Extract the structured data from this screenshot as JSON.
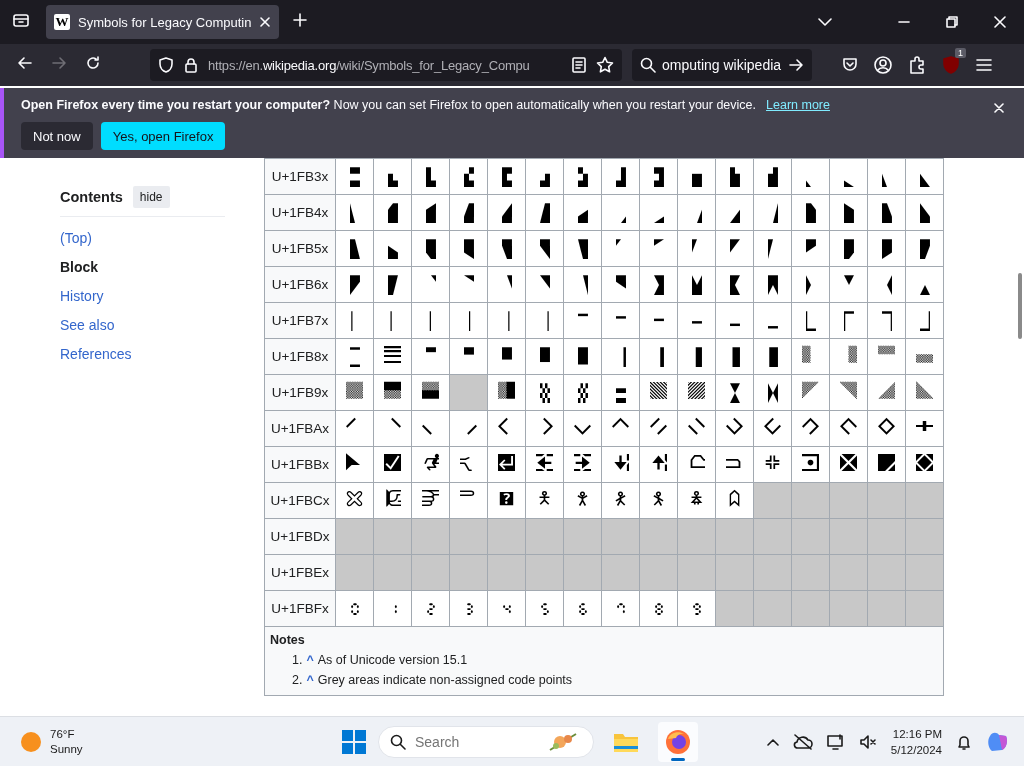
{
  "browser": {
    "tab": {
      "title": "Symbols for Legacy Computin",
      "favicon": "W",
      "selected": true
    },
    "navigation": {
      "back_disabled": false,
      "forward_disabled": true
    },
    "url": {
      "prefix": "https://en.",
      "domain": "wikipedia.org",
      "path": "/wiki/Symbols_for_Legacy_Compu"
    },
    "search": {
      "value": "omputing wikipedia"
    },
    "extension_badge": "1"
  },
  "notification": {
    "message": "**Open Firefox every time you restart your computer?** Now you can set Firefox to open automatically when you restart your device.",
    "link": "Learn more",
    "buttons": [
      {
        "label": "Not now",
        "kind": "secondary"
      },
      {
        "label": "Yes, open Firefox",
        "kind": "primary"
      }
    ]
  },
  "contents": {
    "title": "Contents",
    "toggle": "hide",
    "items": [
      {
        "label": "(Top)",
        "selected": false
      },
      {
        "label": "Block",
        "selected": true
      },
      {
        "label": "History",
        "selected": false
      },
      {
        "label": "See also",
        "selected": false
      },
      {
        "label": "References",
        "selected": false
      }
    ]
  },
  "table": {
    "rows": [
      {
        "label": "U+1FB3x",
        "cells": [
          {
            "char": "🬰",
            "assigned": true
          },
          {
            "char": "🬱",
            "assigned": true
          },
          {
            "char": "🬲",
            "assigned": true
          },
          {
            "char": "🬳",
            "assigned": true
          },
          {
            "char": "🬴",
            "assigned": true
          },
          {
            "char": "🬵",
            "assigned": true
          },
          {
            "char": "🬶",
            "assigned": true
          },
          {
            "char": "🬷",
            "assigned": true
          },
          {
            "char": "🬸",
            "assigned": true
          },
          {
            "char": "🬹",
            "assigned": true
          },
          {
            "char": "🬺",
            "assigned": true
          },
          {
            "char": "🬻",
            "assigned": true
          },
          {
            "char": "🬼",
            "assigned": true
          },
          {
            "char": "🬽",
            "assigned": true
          },
          {
            "char": "🬾",
            "assigned": true
          },
          {
            "char": "🬿",
            "assigned": true
          }
        ]
      },
      {
        "label": "U+1FB4x",
        "cells": [
          {
            "char": "🭀",
            "assigned": true
          },
          {
            "char": "🭁",
            "assigned": true
          },
          {
            "char": "🭂",
            "assigned": true
          },
          {
            "char": "🭃",
            "assigned": true
          },
          {
            "char": "🭄",
            "assigned": true
          },
          {
            "char": "🭅",
            "assigned": true
          },
          {
            "char": "🭆",
            "assigned": true
          },
          {
            "char": "🭇",
            "assigned": true
          },
          {
            "char": "🭈",
            "assigned": true
          },
          {
            "char": "🭉",
            "assigned": true
          },
          {
            "char": "🭊",
            "assigned": true
          },
          {
            "char": "🭋",
            "assigned": true
          },
          {
            "char": "🭌",
            "assigned": true
          },
          {
            "char": "🭍",
            "assigned": true
          },
          {
            "char": "🭎",
            "assigned": true
          },
          {
            "char": "🭏",
            "assigned": true
          }
        ]
      },
      {
        "label": "U+1FB5x",
        "cells": [
          {
            "char": "🭐",
            "assigned": true
          },
          {
            "char": "🭑",
            "assigned": true
          },
          {
            "char": "🭒",
            "assigned": true
          },
          {
            "char": "🭓",
            "assigned": true
          },
          {
            "char": "🭔",
            "assigned": true
          },
          {
            "char": "🭕",
            "assigned": true
          },
          {
            "char": "🭖",
            "assigned": true
          },
          {
            "char": "🭗",
            "assigned": true
          },
          {
            "char": "🭘",
            "assigned": true
          },
          {
            "char": "🭙",
            "assigned": true
          },
          {
            "char": "🭚",
            "assigned": true
          },
          {
            "char": "🭛",
            "assigned": true
          },
          {
            "char": "🭜",
            "assigned": true
          },
          {
            "char": "🭝",
            "assigned": true
          },
          {
            "char": "🭞",
            "assigned": true
          },
          {
            "char": "🭟",
            "assigned": true
          }
        ]
      },
      {
        "label": "U+1FB6x",
        "cells": [
          {
            "char": "🭠",
            "assigned": true
          },
          {
            "char": "🭡",
            "assigned": true
          },
          {
            "char": "🭢",
            "assigned": true
          },
          {
            "char": "🭣",
            "assigned": true
          },
          {
            "char": "🭤",
            "assigned": true
          },
          {
            "char": "🭥",
            "assigned": true
          },
          {
            "char": "🭦",
            "assigned": true
          },
          {
            "char": "🭧",
            "assigned": true
          },
          {
            "char": "🭨",
            "assigned": true
          },
          {
            "char": "🭩",
            "assigned": true
          },
          {
            "char": "🭪",
            "assigned": true
          },
          {
            "char": "🭫",
            "assigned": true
          },
          {
            "char": "🭬",
            "assigned": true
          },
          {
            "char": "🭭",
            "assigned": true
          },
          {
            "char": "🭮",
            "assigned": true
          },
          {
            "char": "🭯",
            "assigned": true
          }
        ]
      },
      {
        "label": "U+1FB7x",
        "cells": [
          {
            "char": "🭰",
            "assigned": true
          },
          {
            "char": "🭱",
            "assigned": true
          },
          {
            "char": "🭲",
            "assigned": true
          },
          {
            "char": "🭳",
            "assigned": true
          },
          {
            "char": "🭴",
            "assigned": true
          },
          {
            "char": "🭵",
            "assigned": true
          },
          {
            "char": "🭶",
            "assigned": true
          },
          {
            "char": "🭷",
            "assigned": true
          },
          {
            "char": "🭸",
            "assigned": true
          },
          {
            "char": "🭹",
            "assigned": true
          },
          {
            "char": "🭺",
            "assigned": true
          },
          {
            "char": "🭻",
            "assigned": true
          },
          {
            "char": "🭼",
            "assigned": true
          },
          {
            "char": "🭽",
            "assigned": true
          },
          {
            "char": "🭾",
            "assigned": true
          },
          {
            "char": "🭿",
            "assigned": true
          }
        ]
      },
      {
        "label": "U+1FB8x",
        "cells": [
          {
            "char": "🮀",
            "assigned": true
          },
          {
            "char": "🮁",
            "assigned": true
          },
          {
            "char": "🮂",
            "assigned": true
          },
          {
            "char": "🮃",
            "assigned": true
          },
          {
            "char": "🮄",
            "assigned": true
          },
          {
            "char": "🮅",
            "assigned": true
          },
          {
            "char": "🮆",
            "assigned": true
          },
          {
            "char": "🮇",
            "assigned": true
          },
          {
            "char": "🮈",
            "assigned": true
          },
          {
            "char": "🮉",
            "assigned": true
          },
          {
            "char": "🮊",
            "assigned": true
          },
          {
            "char": "🮋",
            "assigned": true
          },
          {
            "char": "🮌",
            "assigned": true
          },
          {
            "char": "🮍",
            "assigned": true
          },
          {
            "char": "🮎",
            "assigned": true
          },
          {
            "char": "🮏",
            "assigned": true
          }
        ]
      },
      {
        "label": "U+1FB9x",
        "cells": [
          {
            "char": "🮐",
            "assigned": true
          },
          {
            "char": "🮑",
            "assigned": true
          },
          {
            "char": "🮒",
            "assigned": true
          },
          {
            "assigned": false
          },
          {
            "char": "🮔",
            "assigned": true
          },
          {
            "char": "🮕",
            "assigned": true
          },
          {
            "char": "🮖",
            "assigned": true
          },
          {
            "char": "🮗",
            "assigned": true
          },
          {
            "char": "🮘",
            "assigned": true
          },
          {
            "char": "🮙",
            "assigned": true
          },
          {
            "char": "🮚",
            "assigned": true
          },
          {
            "char": "🮛",
            "assigned": true
          },
          {
            "char": "🮜",
            "assigned": true
          },
          {
            "char": "🮝",
            "assigned": true
          },
          {
            "char": "🮞",
            "assigned": true
          },
          {
            "char": "🮟",
            "assigned": true
          }
        ]
      },
      {
        "label": "U+1FBAx",
        "cells": [
          {
            "char": "🮠",
            "assigned": true
          },
          {
            "char": "🮡",
            "assigned": true
          },
          {
            "char": "🮢",
            "assigned": true
          },
          {
            "char": "🮣",
            "assigned": true
          },
          {
            "char": "🮤",
            "assigned": true
          },
          {
            "char": "🮥",
            "assigned": true
          },
          {
            "char": "🮦",
            "assigned": true
          },
          {
            "char": "🮧",
            "assigned": true
          },
          {
            "char": "🮨",
            "assigned": true
          },
          {
            "char": "🮩",
            "assigned": true
          },
          {
            "char": "🮪",
            "assigned": true
          },
          {
            "char": "🮫",
            "assigned": true
          },
          {
            "char": "🮬",
            "assigned": true
          },
          {
            "char": "🮭",
            "assigned": true
          },
          {
            "char": "🮮",
            "assigned": true
          },
          {
            "char": "🮯",
            "assigned": true
          }
        ]
      },
      {
        "label": "U+1FBBx",
        "cells": [
          {
            "char": "🮰",
            "assigned": true
          },
          {
            "char": "🮱",
            "assigned": true
          },
          {
            "char": "🮲",
            "assigned": true
          },
          {
            "char": "🮳",
            "assigned": true
          },
          {
            "char": "🮴",
            "assigned": true
          },
          {
            "char": "🮵",
            "assigned": true
          },
          {
            "char": "🮶",
            "assigned": true
          },
          {
            "char": "🮷",
            "assigned": true
          },
          {
            "char": "🮸",
            "assigned": true
          },
          {
            "char": "🮹",
            "assigned": true
          },
          {
            "char": "🮺",
            "assigned": true
          },
          {
            "char": "🮻",
            "assigned": true
          },
          {
            "char": "🮼",
            "assigned": true
          },
          {
            "char": "🮽",
            "assigned": true
          },
          {
            "char": "🮾",
            "assigned": true
          },
          {
            "char": "🮿",
            "assigned": true
          }
        ]
      },
      {
        "label": "U+1FBCx",
        "cells": [
          {
            "char": "🯀",
            "assigned": true
          },
          {
            "char": "🯁",
            "assigned": true
          },
          {
            "char": "🯂",
            "assigned": true
          },
          {
            "char": "🯃",
            "assigned": true
          },
          {
            "char": "🯄",
            "assigned": true
          },
          {
            "char": "🯅",
            "assigned": true
          },
          {
            "char": "🯆",
            "assigned": true
          },
          {
            "char": "🯇",
            "assigned": true
          },
          {
            "char": "🯈",
            "assigned": true
          },
          {
            "char": "🯉",
            "assigned": true
          },
          {
            "char": "🯊",
            "assigned": true
          },
          {
            "assigned": false
          },
          {
            "assigned": false
          },
          {
            "assigned": false
          },
          {
            "assigned": false
          },
          {
            "assigned": false
          }
        ]
      },
      {
        "label": "U+1FBDx",
        "cells": [
          {
            "assigned": false
          },
          {
            "assigned": false
          },
          {
            "assigned": false
          },
          {
            "assigned": false
          },
          {
            "assigned": false
          },
          {
            "assigned": false
          },
          {
            "assigned": false
          },
          {
            "assigned": false
          },
          {
            "assigned": false
          },
          {
            "assigned": false
          },
          {
            "assigned": false
          },
          {
            "assigned": false
          },
          {
            "assigned": false
          },
          {
            "assigned": false
          },
          {
            "assigned": false
          },
          {
            "assigned": false
          }
        ]
      },
      {
        "label": "U+1FBEx",
        "cells": [
          {
            "assigned": false
          },
          {
            "assigned": false
          },
          {
            "assigned": false
          },
          {
            "assigned": false
          },
          {
            "assigned": false
          },
          {
            "assigned": false
          },
          {
            "assigned": false
          },
          {
            "assigned": false
          },
          {
            "assigned": false
          },
          {
            "assigned": false
          },
          {
            "assigned": false
          },
          {
            "assigned": false
          },
          {
            "assigned": false
          },
          {
            "assigned": false
          },
          {
            "assigned": false
          },
          {
            "assigned": false
          }
        ]
      },
      {
        "label": "U+1FBFx",
        "cells": [
          {
            "char": "🯰",
            "assigned": true
          },
          {
            "char": "🯱",
            "assigned": true
          },
          {
            "char": "🯲",
            "assigned": true
          },
          {
            "char": "🯳",
            "assigned": true
          },
          {
            "char": "🯴",
            "assigned": true
          },
          {
            "char": "🯵",
            "assigned": true
          },
          {
            "char": "🯶",
            "assigned": true
          },
          {
            "char": "🯷",
            "assigned": true
          },
          {
            "char": "🯸",
            "assigned": true
          },
          {
            "char": "🯹",
            "assigned": true
          },
          {
            "assigned": false
          },
          {
            "assigned": false
          },
          {
            "assigned": false
          },
          {
            "assigned": false
          },
          {
            "assigned": false
          },
          {
            "assigned": false
          }
        ]
      }
    ]
  },
  "notes": {
    "title": "Notes",
    "items": [
      {
        "number": "1.",
        "caret": "^",
        "text": "As of Unicode version 15.1"
      },
      {
        "number": "2.",
        "caret": "^",
        "text": "Grey areas indicate non-assigned code points"
      }
    ]
  },
  "taskbar": {
    "weather": {
      "temperature": "76°F",
      "condition": "Sunny"
    },
    "search_placeholder": "Search",
    "apps": [
      {
        "kind": "explorer",
        "active": false
      },
      {
        "kind": "firefox",
        "active": true
      }
    ],
    "time": "12:16 PM",
    "date": "5/12/2024"
  }
}
